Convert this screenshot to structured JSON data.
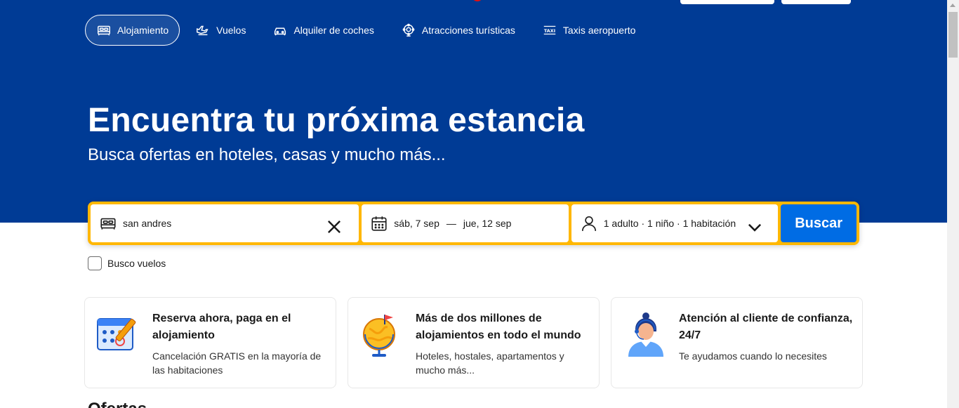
{
  "nav": {
    "tabs": [
      {
        "label": "Alojamiento",
        "icon": "bed-icon",
        "active": true
      },
      {
        "label": "Vuelos",
        "icon": "plane-icon",
        "active": false
      },
      {
        "label": "Alquiler de coches",
        "icon": "car-icon",
        "active": false
      },
      {
        "label": "Atracciones turísticas",
        "icon": "attractions-icon",
        "active": false
      },
      {
        "label": "Taxis aeropuerto",
        "icon": "taxi-icon",
        "active": false
      }
    ]
  },
  "hero": {
    "title": "Encuentra tu próxima estancia",
    "subtitle": "Busca ofertas en hoteles, casas y mucho más..."
  },
  "search": {
    "destination_value": "san andres",
    "checkin": "sáb, 7 sep",
    "separator": "—",
    "checkout": "jue, 12 sep",
    "guests": "1 adulto · 1 niño · 1 habitación",
    "button_label": "Buscar",
    "flights_checkbox_label": "Busco vuelos"
  },
  "cards": [
    {
      "title": "Reserva ahora, paga en el alojamiento",
      "desc": "Cancelación GRATIS en la mayoría de las habitaciones"
    },
    {
      "title": "Más de dos millones de alojamientos en todo el mundo",
      "desc": "Hoteles, hostales, apartamentos y mucho más..."
    },
    {
      "title": "Atención al cliente de confianza, 24/7",
      "desc": "Te ayudamos cuando lo necesites"
    }
  ],
  "offers": {
    "title": "Ofertas"
  },
  "colors": {
    "brand_blue": "#003b95",
    "search_border": "#ffb700",
    "button_blue": "#006ce4"
  }
}
